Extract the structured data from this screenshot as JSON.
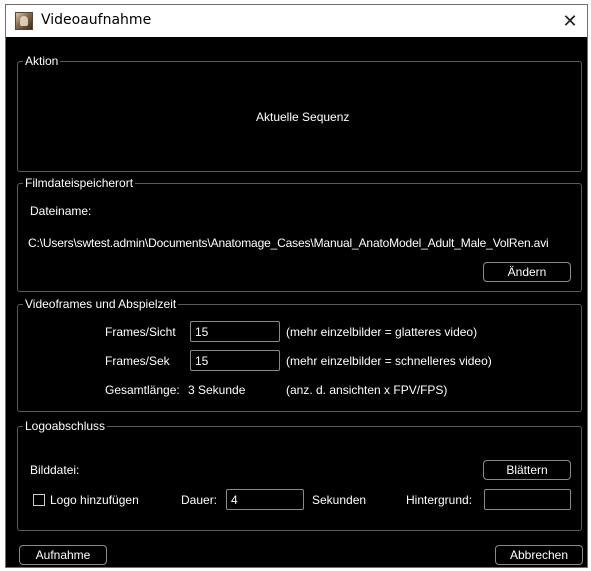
{
  "window": {
    "title": "Videoaufnahme",
    "close_glyph": "✕"
  },
  "action": {
    "legend": "Aktion",
    "value": "Aktuelle Sequenz"
  },
  "file": {
    "legend": "Filmdateispeicherort",
    "filename_label": "Dateiname:",
    "path": "C:\\Users\\swtest.admin\\Documents\\Anatomage_Cases\\Manual_AnatoModel_Adult_Male_VolRen.avi",
    "change_button": "Ändern"
  },
  "video": {
    "legend": "Videoframes und Abspielzeit",
    "frames_per_view_label": "Frames/Sicht",
    "frames_per_view_value": "15",
    "frames_per_view_hint": "(mehr einzelbilder = glatteres video)",
    "frames_per_sec_label": "Frames/Sek",
    "frames_per_sec_value": "15",
    "frames_per_sec_hint": "(mehr einzelbilder = schnelleres video)",
    "total_length_label": "Gesamtlänge:",
    "total_length_value": "3 Sekunde",
    "total_length_hint": "(anz. d. ansichten x FPV/FPS)"
  },
  "logo": {
    "legend": "Logoabschluss",
    "image_file_label": "Bilddatei:",
    "browse_button": "Blättern",
    "add_logo_label": "Logo hinzufügen",
    "add_logo_checked": false,
    "duration_label": "Dauer:",
    "duration_value": "4",
    "seconds_label": "Sekunden",
    "background_label": "Hintergrund:",
    "background_color": "#000000"
  },
  "footer": {
    "record_button": "Aufnahme",
    "cancel_button": "Abbrechen"
  },
  "colors": {
    "dialog_bg": "#000000",
    "text": "#ffffff",
    "border": "#5b5b5b"
  }
}
